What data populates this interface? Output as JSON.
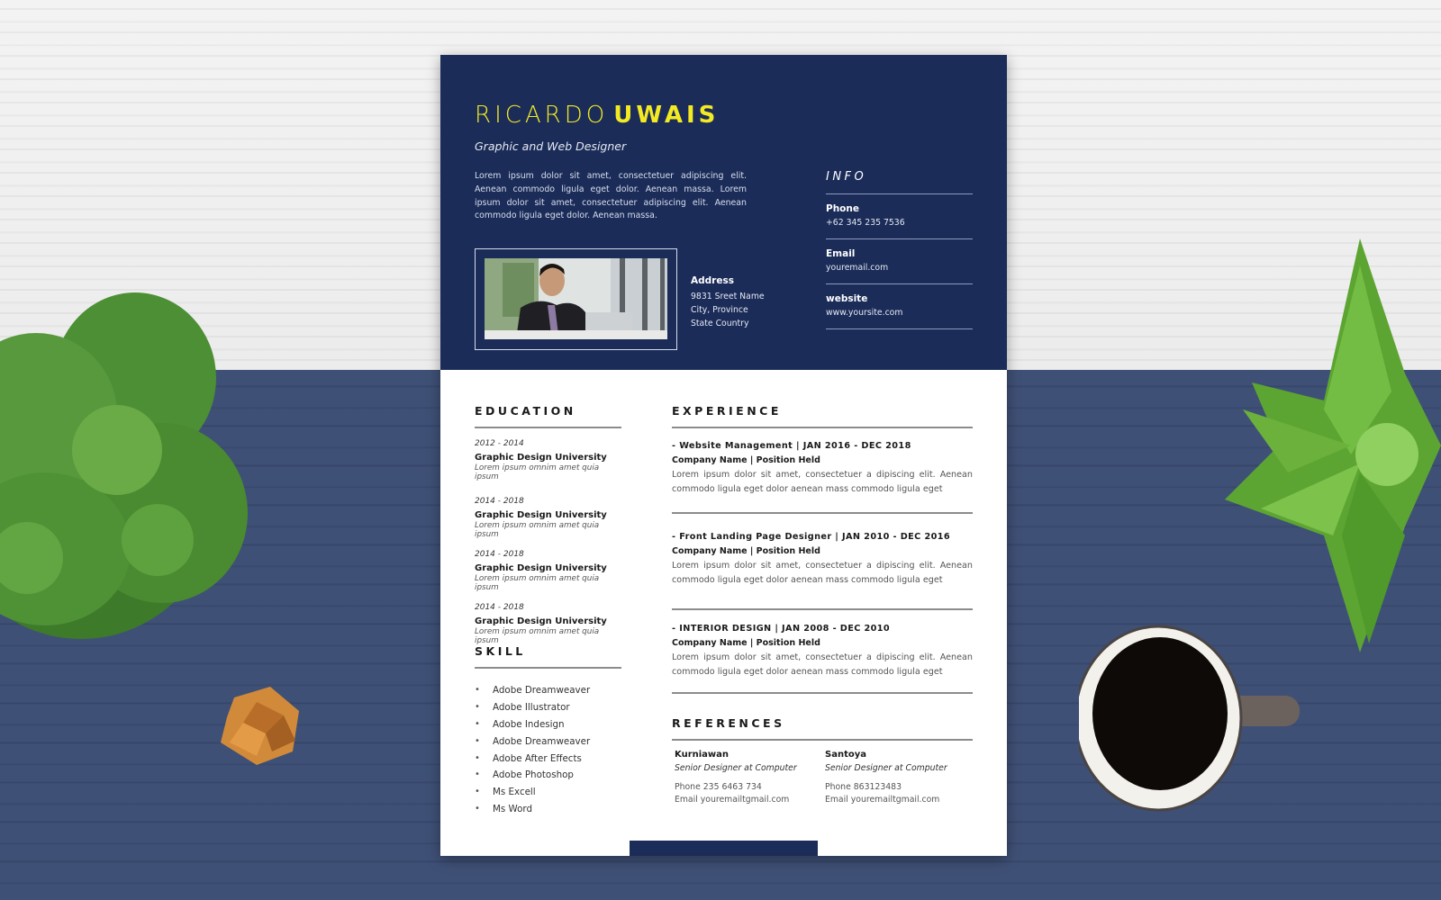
{
  "colors": {
    "header_bg": "#1b2c59",
    "name_accent": "#f3ea23",
    "table_navy": "#3f5076",
    "table_white": "#f0f0f0"
  },
  "resume": {
    "name_first": "RICARDO",
    "name_last": "UWAIS",
    "title": "Graphic and Web Designer",
    "summary": "Lorem ipsum dolor sit amet, consectetuer adipiscing elit. Aenean commodo ligula eget dolor. Aenean massa. Lorem ipsum dolor sit amet, consectetuer adipiscing elit. Aenean commodo ligula eget dolor. Aenean massa.",
    "address": {
      "label": "Address",
      "lines": [
        "9831 Sreet Name",
        "City, Province",
        "State Country"
      ]
    },
    "info": {
      "heading": "INFO",
      "items": [
        {
          "label": "Phone",
          "value": "+62 345 235 7536"
        },
        {
          "label": "Email",
          "value": "youremail.com"
        },
        {
          "label": "website",
          "value": "www.yoursite.com"
        }
      ]
    },
    "education": {
      "heading": "EDUCATION",
      "items": [
        {
          "years": "2012 - 2014",
          "school": "Graphic Design University",
          "desc": "Lorem ipsum omnim amet quia ipsum"
        },
        {
          "years": "2014 - 2018",
          "school": "Graphic Design University",
          "desc": "Lorem ipsum omnim amet quia ipsum"
        },
        {
          "years": "2014 - 2018",
          "school": "Graphic Design University",
          "desc": "Lorem ipsum omnim amet quia ipsum"
        },
        {
          "years": "2014 - 2018",
          "school": "Graphic Design University",
          "desc": "Lorem ipsum omnim amet quia ipsum"
        }
      ]
    },
    "skill": {
      "heading": "SKILL",
      "bullet": "•",
      "items": [
        "Adobe Dreamweaver",
        "Adobe Illustrator",
        "Adobe Indesign",
        "Adobe Dreamweaver",
        "Adobe After Effects",
        "Adobe Photoshop",
        "Ms Excell",
        "Ms Word"
      ]
    },
    "experience": {
      "heading": "EXPERIENCE",
      "items": [
        {
          "title": "- Website Management  |  JAN 2016 - DEC 2018",
          "company": "Company Name | Position Held",
          "text": "Lorem ipsum dolor sit amet, consectetuer a dipiscing elit.  Aenean commodo  ligula eget  dolor aenean mass commodo  ligula eget"
        },
        {
          "title": "- Front Landing Page Designer |  JAN 2010 - DEC 2016",
          "company": "Company Name | Position Held",
          "text": "Lorem ipsum dolor sit amet, consectetuer a dipiscing elit.  Aenean commodo  ligula eget  dolor aenean mass commodo  ligula eget"
        },
        {
          "title": "- INTERIOR DESIGN  |  JAN 2008 - DEC 2010",
          "company": "Company Name | Position Held",
          "text": "Lorem ipsum dolor sit amet, consectetuer a dipiscing elit.  Aenean commodo  ligula eget  dolor aenean mass commodo  ligula eget"
        }
      ]
    },
    "references": {
      "heading": "REFERENCES",
      "items": [
        {
          "name": "Kurniawan",
          "role": "Senior Designer at Computer",
          "phone": "Phone 235 6463 734",
          "email": "Email youremailtgmail.com"
        },
        {
          "name": "Santoya",
          "role": "Senior Designer at Computer",
          "phone": "Phone 863123483",
          "email": "Email youremailtgmail.com"
        }
      ]
    }
  }
}
